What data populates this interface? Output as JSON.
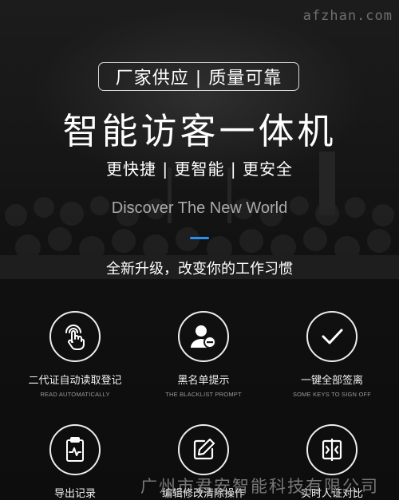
{
  "watermark_top": "afzhan.com",
  "tagline": "厂家供应 | 质量可靠",
  "title": "智能访客一体机",
  "features_line": "更快捷 | 更智能 | 更安全",
  "discover": "Discover The New World",
  "upgrade_text": "全新升级，改变你的工作习惯",
  "accent_color": "#2a8ff0",
  "features": [
    {
      "icon": "touch-icon",
      "cn": "二代证自动读取登记",
      "en": "READ AUTOMATICALLY"
    },
    {
      "icon": "user-blacklist-icon",
      "cn": "黑名单提示",
      "en": "THE BLACKLIST PROMPT"
    },
    {
      "icon": "checkmark-icon",
      "cn": "一键全部签离",
      "en": "SOME KEYS TO SIGN OFF"
    },
    {
      "icon": "clipboard-export-icon",
      "cn": "导出记录",
      "en": ""
    },
    {
      "icon": "edit-icon",
      "cn": "编辑修改清除操作",
      "en": ""
    },
    {
      "icon": "compare-icon",
      "cn": "实时人证对比",
      "en": ""
    }
  ],
  "watermark_bottom": "广州市君安智能科技有限公司"
}
